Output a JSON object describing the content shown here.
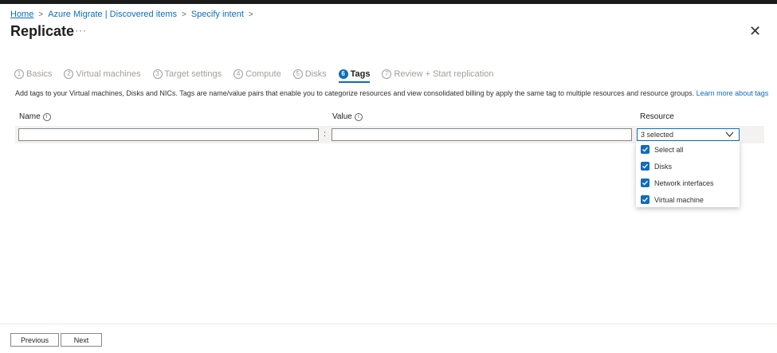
{
  "breadcrumb": [
    "Home",
    "Azure Migrate | Discovered items",
    "Specify intent"
  ],
  "page_title": "Replicate",
  "more_label": "···",
  "close_label": "✕",
  "steps": [
    {
      "num": "1",
      "label": "Basics"
    },
    {
      "num": "2",
      "label": "Virtual machines"
    },
    {
      "num": "3",
      "label": "Target settings"
    },
    {
      "num": "4",
      "label": "Compute"
    },
    {
      "num": "5",
      "label": "Disks"
    },
    {
      "num": "6",
      "label": "Tags"
    },
    {
      "num": "7",
      "label": "Review + Start replication"
    }
  ],
  "active_step": "Tags",
  "description": "Add tags to your Virtual machines, Disks and NICs. Tags are name/value pairs that enable you to categorize resources and view consolidated billing by apply the same tag to multiple resources and resource groups.",
  "learn_more": "Learn more about tags",
  "columns": {
    "name": "Name",
    "value": "Value",
    "resource": "Resource"
  },
  "row": {
    "name_value": "",
    "value_value": "",
    "separator": ":",
    "resource_selected": "3 selected"
  },
  "resource_options": [
    {
      "label": "Select all",
      "checked": true
    },
    {
      "label": "Disks",
      "checked": true
    },
    {
      "label": "Network interfaces",
      "checked": true
    },
    {
      "label": "Virtual machine",
      "checked": true
    }
  ],
  "footer": {
    "previous": "Previous",
    "next": "Next"
  },
  "colors": {
    "accent": "#0f6cbd",
    "topbar": "#1b1b1b"
  }
}
